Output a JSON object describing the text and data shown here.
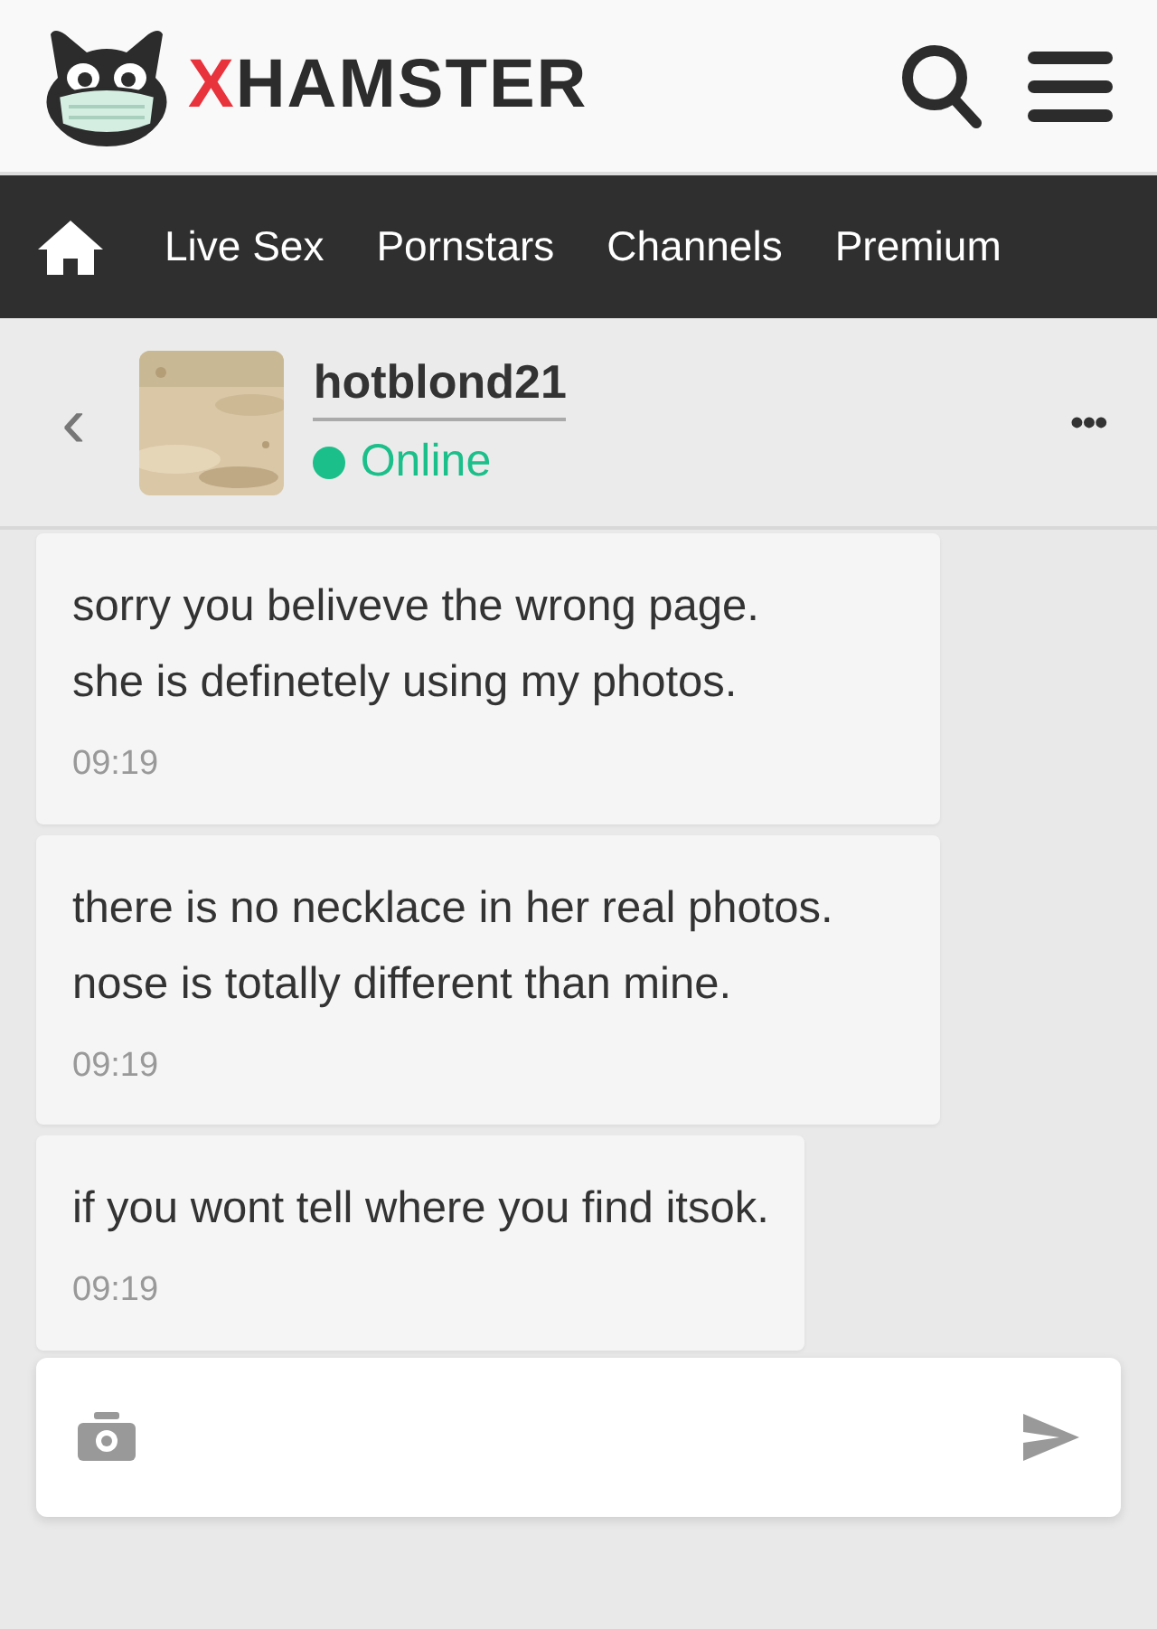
{
  "logo": {
    "accent": "X",
    "rest": "HAMSTER"
  },
  "nav": [
    {
      "label": "Live Sex"
    },
    {
      "label": "Pornstars"
    },
    {
      "label": "Channels"
    },
    {
      "label": "Premium"
    }
  ],
  "chat_header": {
    "back": "‹",
    "username": "hotblond21",
    "status": "Online",
    "online": true,
    "more": "•••"
  },
  "messages": [
    {
      "lines": [
        "sorry you beliveve the wrong page.",
        "she is definetely using my photos."
      ],
      "time": "09:19"
    },
    {
      "lines": [
        "there is no necklace in her real photos.",
        "nose is totally different than mine."
      ],
      "time": "09:19"
    },
    {
      "lines": [
        "if you wont tell where you find itsok."
      ],
      "time": "09:19"
    }
  ]
}
